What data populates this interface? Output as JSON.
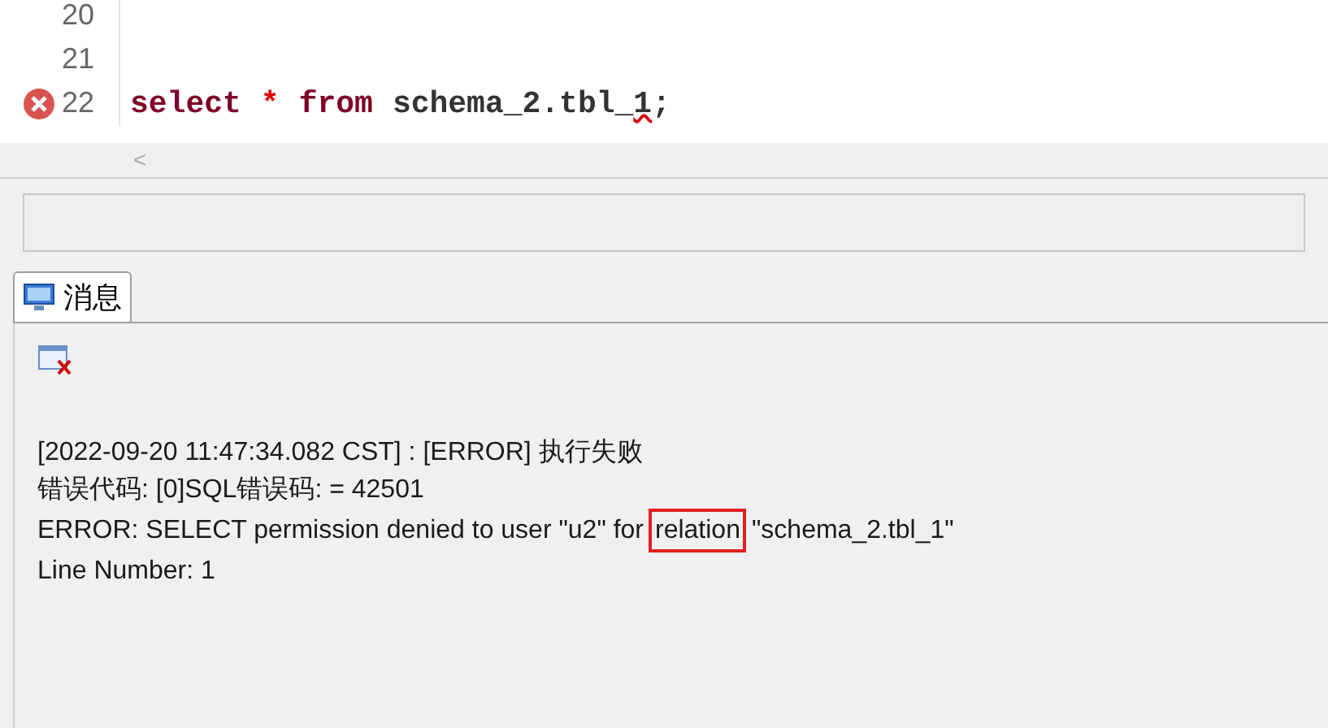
{
  "editor": {
    "lines": [
      {
        "number": "20",
        "error": false
      },
      {
        "number": "21",
        "error": false
      },
      {
        "number": "22",
        "error": true,
        "tokens": [
          {
            "kind": "keyword",
            "text": "select",
            "squiggle": false
          },
          {
            "kind": "operator",
            "text": "*",
            "squiggle": false
          },
          {
            "kind": "keyword",
            "text": "from",
            "squiggle": false
          },
          {
            "kind": "identifier",
            "text": "schema_2.tbl_",
            "squiggle": false
          },
          {
            "kind": "identifier",
            "text": "1",
            "squiggle": true
          },
          {
            "kind": "identifier",
            "text": ";",
            "squiggle": false
          }
        ]
      }
    ],
    "scroll_left": "<"
  },
  "tabs": [
    {
      "label": "消息",
      "selected": true
    }
  ],
  "messages": [
    {
      "parts": [
        {
          "text": "[2022-09-20 11:47:34.082 CST] : [ERROR] 执行失败",
          "highlighted": false
        }
      ]
    },
    {
      "parts": [
        {
          "text": "错误代码: [0]SQL错误码: = 42501",
          "highlighted": false
        }
      ]
    },
    {
      "parts": [
        {
          "text": "ERROR: SELECT permission denied to user \"u2\" for",
          "highlighted": false
        },
        {
          "text": "relation",
          "highlighted": true
        },
        {
          "text": "\"schema_2.tbl_1\"",
          "highlighted": false
        }
      ]
    },
    {
      "parts": [
        {
          "text": "Line Number: 1",
          "highlighted": false
        }
      ]
    }
  ]
}
